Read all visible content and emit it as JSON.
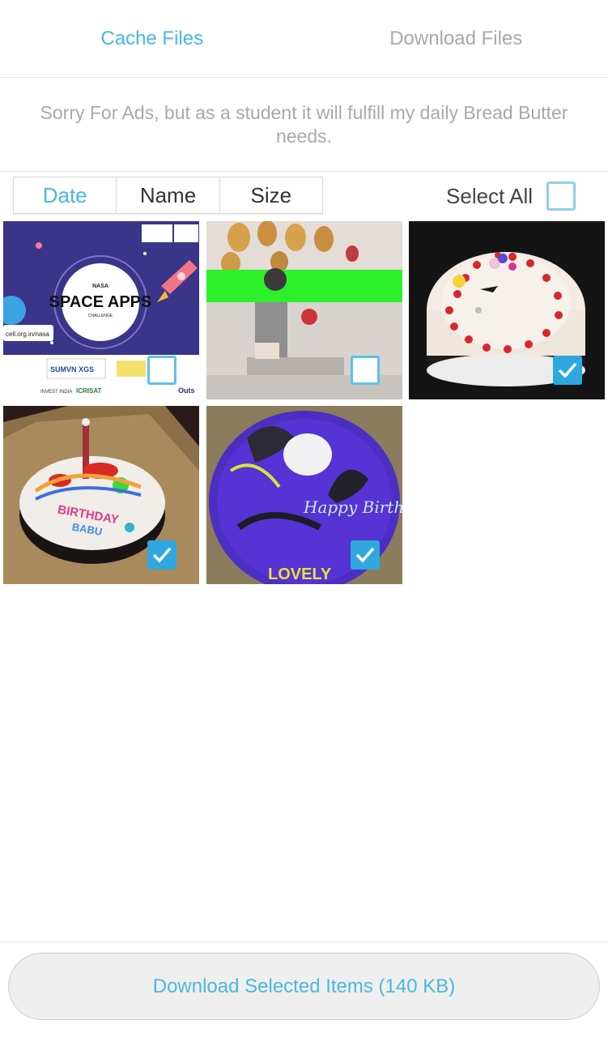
{
  "tabs": [
    {
      "label": "Cache Files",
      "active": true
    },
    {
      "label": "Download Files",
      "active": false
    }
  ],
  "notice": "Sorry For Ads, but as a student it will fulfill my daily Bread Butter needs.",
  "sort": {
    "options": [
      "Date",
      "Name",
      "Size"
    ],
    "active": "Date",
    "select_all_label": "Select All",
    "select_all_checked": false
  },
  "items": [
    {
      "image": "nasa-space-apps-poster",
      "checked": false,
      "text": {
        "title": "SPACE APPS",
        "top": "NASA",
        "bottom": "CHALLENGE",
        "url": "cell.org.in/nasa",
        "sponsor1": "SUMVN XGS",
        "sponsor2": "INVEST INDIA",
        "sponsor3": "ICRISAT",
        "side": "Outs"
      }
    },
    {
      "image": "birthday-party-photo",
      "checked": false
    },
    {
      "image": "cream-cake-photo",
      "checked": true
    },
    {
      "image": "birthday-babu-cake-photo",
      "checked": true,
      "text": {
        "cake": "BIRTHDAY",
        "name": "BABU"
      }
    },
    {
      "image": "purple-happy-birthday-cake-photo",
      "checked": true,
      "text": {
        "cake": "Happy Birthday",
        "name": "LOVELY"
      }
    }
  ],
  "download_button": "Download Selected Items (140 KB)",
  "colors": {
    "accent": "#4ab8dc",
    "check": "#2ea8df",
    "muted": "#a9a9a9"
  }
}
